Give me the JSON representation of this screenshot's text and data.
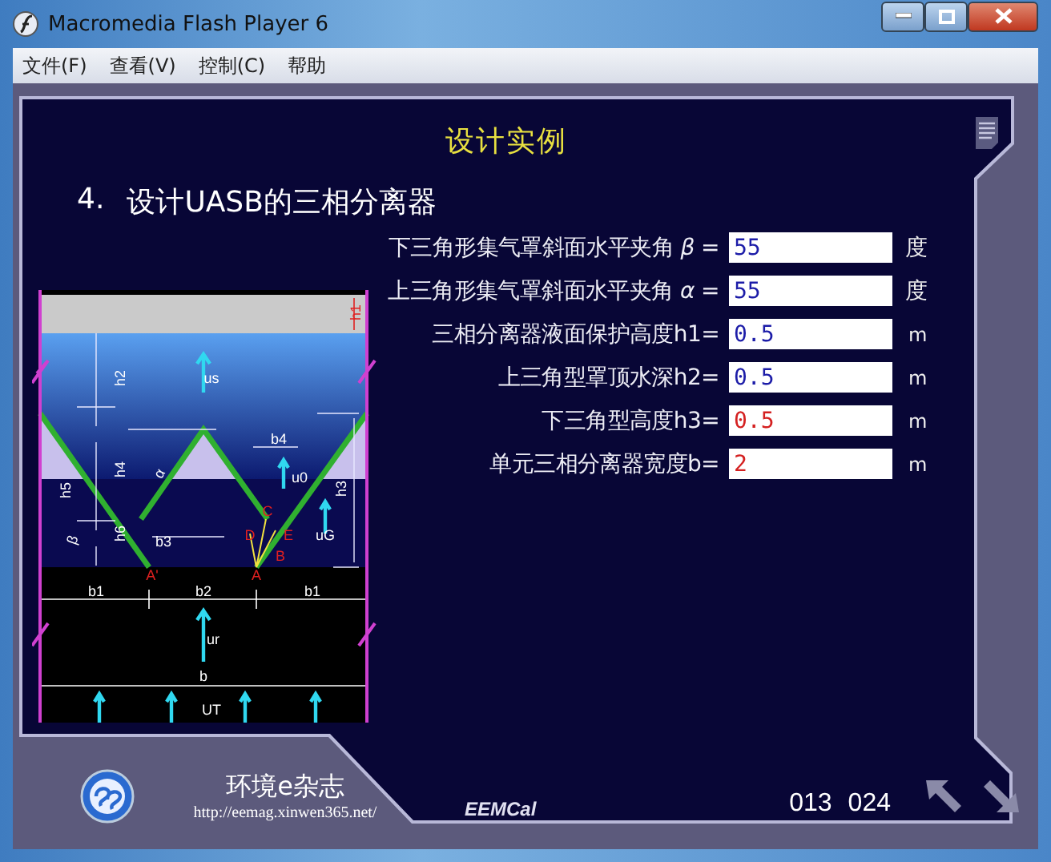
{
  "window": {
    "title": "Macromedia Flash Player 6"
  },
  "menu": [
    "文件(F)",
    "查看(V)",
    "控制(C)",
    "帮助"
  ],
  "slide": {
    "title": "设计实例",
    "number": "4.",
    "heading": "设计UASB的三相分离器"
  },
  "diagram": {
    "labels": [
      "h1",
      "h2",
      "us",
      "h4",
      "h5",
      "h6",
      "β",
      "b3",
      "α",
      "b4",
      "u0",
      "h3",
      "uG",
      "A'",
      "A",
      "C",
      "D",
      "E",
      "B",
      "b1",
      "b2",
      "b1",
      "ur",
      "b",
      "UT"
    ]
  },
  "fields": [
    {
      "label": "下三角形集气罩斜面水平夹角 *β* =",
      "value": "55",
      "unit": "度",
      "color": "#1c1ca8"
    },
    {
      "label": "上三角形集气罩斜面水平夹角 *α* =",
      "value": "55",
      "unit": "度",
      "color": "#1c1ca8"
    },
    {
      "label": "三相分离器液面保护高度h1=",
      "value": "0.5",
      "unit": "m",
      "color": "#1c1ca8"
    },
    {
      "label": "上三角型罩顶水深h2=",
      "value": "0.5",
      "unit": "m",
      "color": "#1c1ca8"
    },
    {
      "label": "下三角型高度h3=",
      "value": "0.5",
      "unit": "m",
      "color": "#d42020"
    },
    {
      "label": "单元三相分离器宽度b=",
      "value": "2",
      "unit": "m",
      "color": "#d42020"
    }
  ],
  "footer": {
    "brand": "环境e杂志",
    "url": "http://eemag.xinwen365.net/",
    "credit": "EEMCal",
    "page": "013",
    "total": "024"
  }
}
